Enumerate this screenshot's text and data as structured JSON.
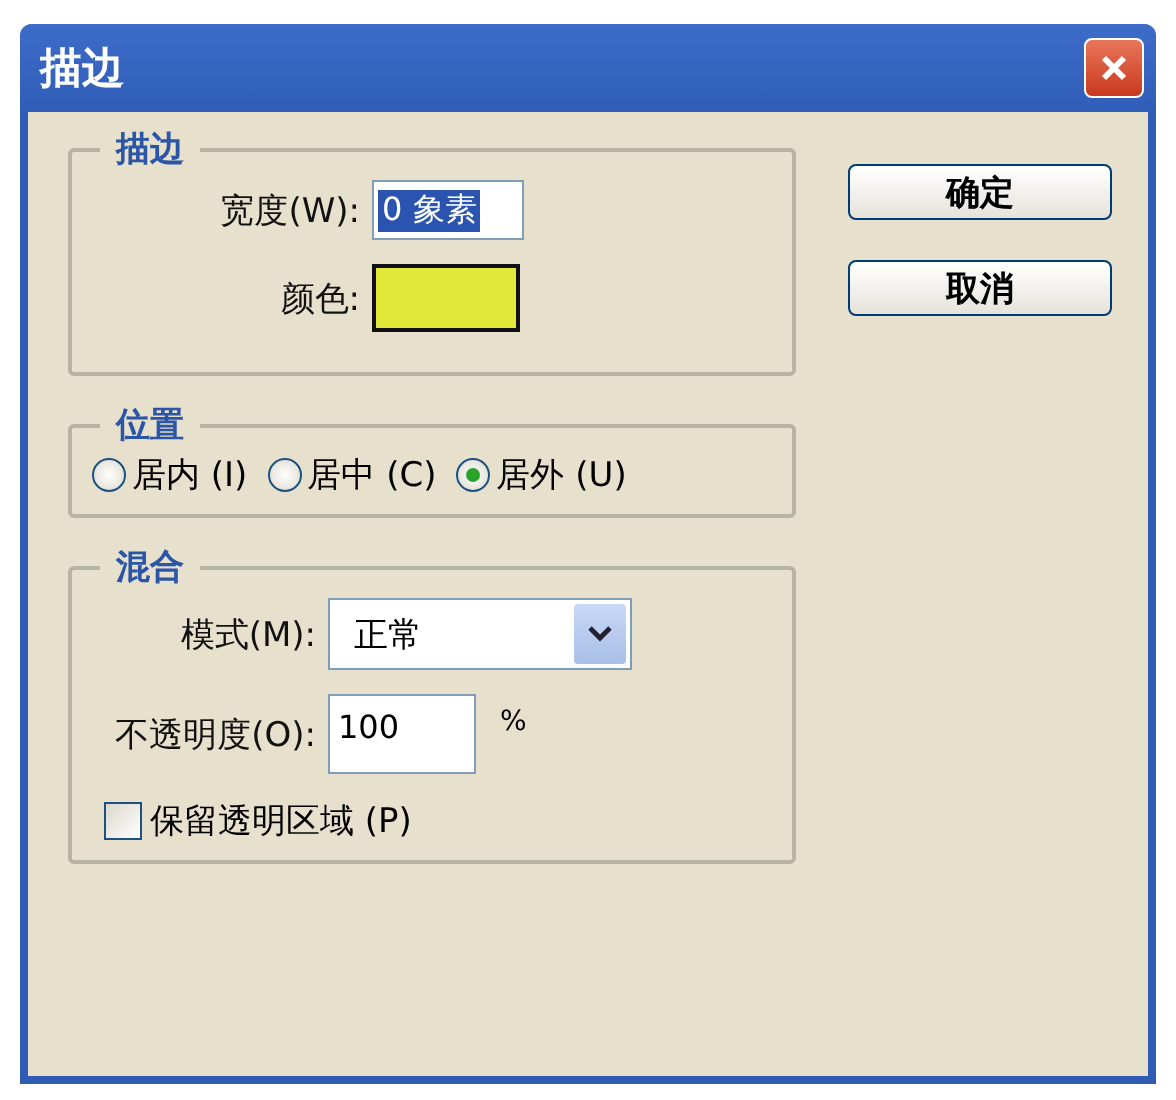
{
  "window": {
    "title": "描边"
  },
  "groups": [
    {
      "kind": "stroke",
      "title": "描边",
      "width": {
        "label": "宽度(W):",
        "value": "0 象素",
        "selected": true
      },
      "color": {
        "label": "颜色:",
        "color": "#e2e83a"
      }
    },
    {
      "kind": "position",
      "title": "位置",
      "options": [
        {
          "label": "居内 (I)",
          "selected": false
        },
        {
          "label": "居中 (C)",
          "selected": false
        },
        {
          "label": "居外 (U)",
          "selected": true
        }
      ]
    },
    {
      "kind": "blend",
      "title": "混合",
      "mode": {
        "label": "模式(M):",
        "value": "正常"
      },
      "opacity": {
        "label": "不透明度(O):",
        "value": "100",
        "unit": "%"
      },
      "preserve": {
        "label": "保留透明区域 (P)",
        "checked": false
      }
    }
  ],
  "buttons": [
    "确定",
    "取消"
  ]
}
